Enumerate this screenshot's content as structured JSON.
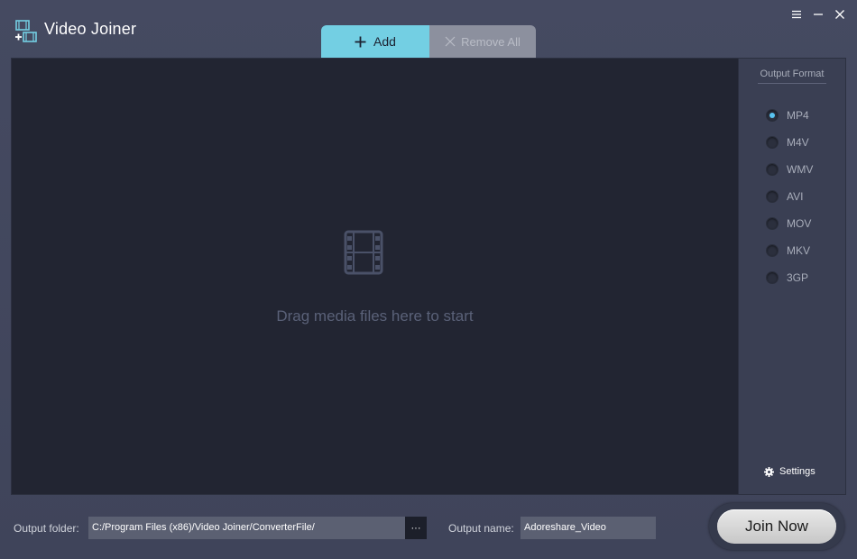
{
  "app": {
    "title": "Video Joiner"
  },
  "toolbar": {
    "add_label": "Add",
    "remove_all_label": "Remove All"
  },
  "drop_zone": {
    "hint": "Drag media files here to start"
  },
  "output_format": {
    "title": "Output Format",
    "options": [
      "MP4",
      "M4V",
      "WMV",
      "AVI",
      "MOV",
      "MKV",
      "3GP"
    ],
    "selected": "MP4"
  },
  "settings": {
    "label": "Settings"
  },
  "bottom": {
    "output_folder_label": "Output folder:",
    "output_folder_value": "C:/Program Files (x86)/Video Joiner/ConverterFile/",
    "browse_label": "···",
    "output_name_label": "Output name:",
    "output_name_value": "Adoreshare_Video",
    "join_label": "Join Now"
  },
  "colors": {
    "accent": "#73cfe3",
    "background": "#43485f",
    "drop_zone": "#222532",
    "radio_checked": "#58c3f0"
  }
}
